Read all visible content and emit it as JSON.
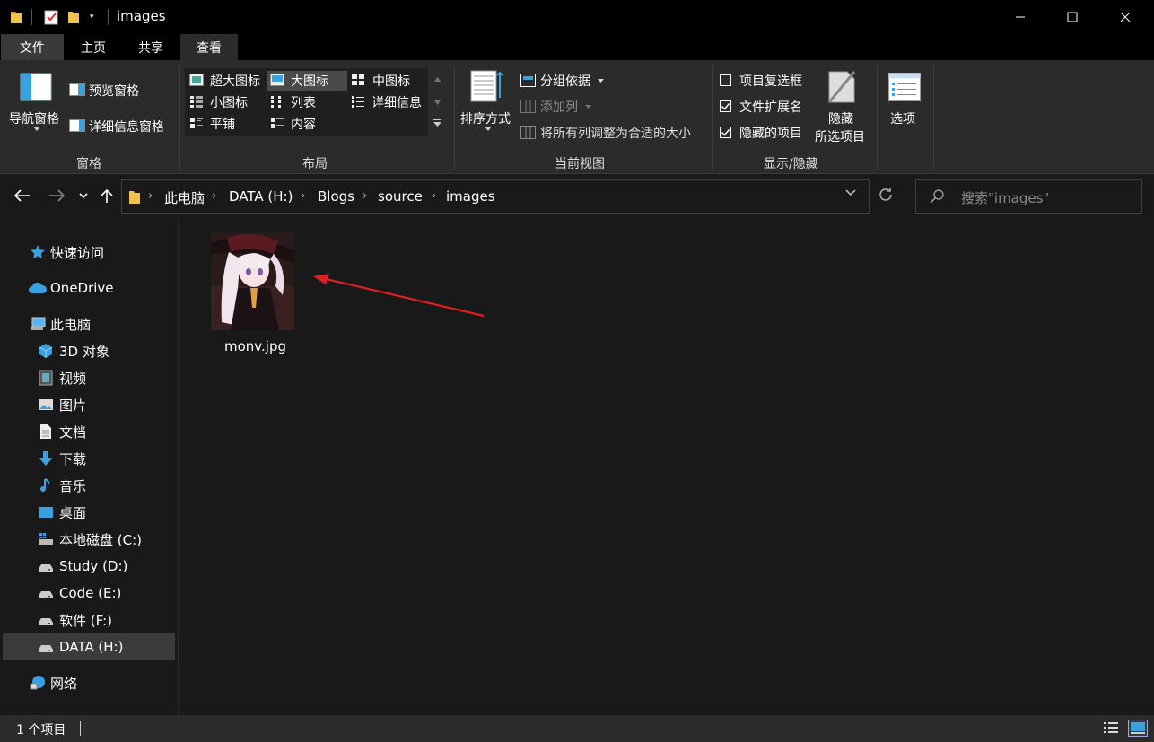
{
  "window": {
    "title": "images",
    "minimize_glyph": "—",
    "maximize_glyph": "☐",
    "close_glyph": "✕",
    "qat_dropdown_glyph": "▾"
  },
  "tabs": [
    {
      "label": "文件"
    },
    {
      "label": "主页"
    },
    {
      "label": "共享"
    },
    {
      "label": "查看"
    }
  ],
  "ribbon": {
    "groups": {
      "pane_label": "窗格",
      "layout_label": "布局",
      "current_view_label": "当前视图",
      "show_hide_label": "显示/隐藏"
    },
    "pane": {
      "nav_pane": "导航窗格",
      "preview_pane": "预览窗格",
      "details_pane": "详细信息窗格"
    },
    "layout": {
      "extra_large": "超大图标",
      "large": "大图标",
      "medium": "中图标",
      "small": "小图标",
      "list": "列表",
      "details": "详细信息",
      "tiles": "平铺",
      "content": "内容"
    },
    "current_view": {
      "sort_by": "排序方式",
      "group_by": "分组依据",
      "add_columns": "添加列",
      "size_all_columns": "将所有列调整为合适的大小"
    },
    "show_hide": {
      "item_checkboxes": "项目复选框",
      "item_checkboxes_checked": false,
      "file_extensions": "文件扩展名",
      "file_extensions_checked": true,
      "hidden_items": "隐藏的项目",
      "hidden_items_checked": true,
      "hide_selected_line1": "隐藏",
      "hide_selected_line2": "所选项目",
      "options": "选项"
    }
  },
  "address": {
    "crumbs": [
      "此电脑",
      "DATA (H:)",
      "Blogs",
      "source",
      "images"
    ],
    "search_placeholder": "搜索\"images\""
  },
  "sidebar": {
    "items": [
      {
        "label": "快速访问",
        "icon": "star-icon"
      },
      {
        "label": "OneDrive",
        "icon": "cloud-icon"
      },
      {
        "label": "此电脑",
        "icon": "computer-icon"
      },
      {
        "label": "3D 对象",
        "icon": "cube-icon"
      },
      {
        "label": "视频",
        "icon": "video-icon"
      },
      {
        "label": "图片",
        "icon": "picture-icon"
      },
      {
        "label": "文档",
        "icon": "document-icon"
      },
      {
        "label": "下载",
        "icon": "download-icon"
      },
      {
        "label": "音乐",
        "icon": "music-icon"
      },
      {
        "label": "桌面",
        "icon": "desktop-icon"
      },
      {
        "label": "本地磁盘 (C:)",
        "icon": "windows-drive-icon"
      },
      {
        "label": "Study (D:)",
        "icon": "drive-icon"
      },
      {
        "label": "Code (E:)",
        "icon": "drive-icon"
      },
      {
        "label": "软件 (F:)",
        "icon": "drive-icon"
      },
      {
        "label": "DATA (H:)",
        "icon": "drive-icon",
        "selected": true
      },
      {
        "label": "网络",
        "icon": "network-icon"
      }
    ]
  },
  "files": [
    {
      "name": "monv.jpg"
    }
  ],
  "status": {
    "item_count": "1 个项目"
  },
  "colors": {
    "accent": "#1c7ed6",
    "folder": "#f0c14b",
    "annotation_arrow": "#e02020"
  }
}
